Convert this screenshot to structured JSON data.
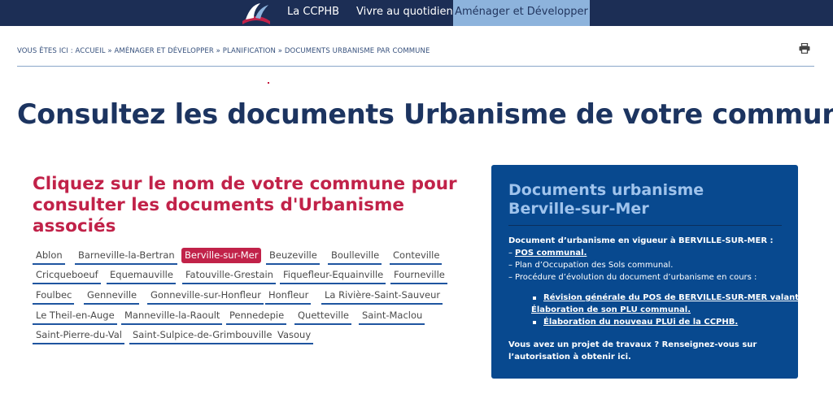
{
  "nav": {
    "items": [
      {
        "label": "La CCPHB"
      },
      {
        "label": "Vivre au quotidien"
      },
      {
        "label": "Aménager et Développer",
        "active": true
      }
    ],
    "colors": {
      "bar": "#1c2e55",
      "active_bg": "#8db3dc"
    }
  },
  "breadcrumb": "VOUS ÊTES ICI : ACCUEIL » AMÉNAGER ET DÉVELOPPER » PLANIFICATION » DOCUMENTS URBANISME PAR COMMUNE",
  "page_title": "Consultez les documents Urbanisme de votre commune",
  "left": {
    "heading": "Cliquez sur le nom de votre commune pour consulter les documents d'Urbanisme associés",
    "selected": "Berville-sur-Mer",
    "communes": [
      "Ablon",
      "Barneville-la-Bertran",
      "Berville-sur-Mer",
      "Beuzeville",
      "Boulleville",
      "Conteville",
      "Cricqueboeuf",
      "Equemauville",
      "Fatouville-Grestain",
      "Fiquefleur-Equainville",
      "Fourneville",
      "Foulbec",
      "Genneville",
      "Gonneville-sur-Honfleur",
      "Honfleur",
      "La Rivière-Saint-Sauveur",
      "Le Theil-en-Auge",
      "Manneville-la-Raoult",
      "Pennedepie",
      "Quetteville",
      "Saint-Maclou",
      "Saint-Pierre-du-Val",
      "Saint-Sulpice-de-Grimbouville",
      "Vasouy"
    ]
  },
  "panel": {
    "title": "Documents urbanisme Berville-sur-Mer",
    "in_force": "Document d’urbanisme en vigueur à BERVILLE-SUR-MER :",
    "pos_link": "POS communal.",
    "pos_text": "Plan d’Occupation des Sols communal.",
    "procedure": "Procédure d’évolution du document d’urbanisme en cours :",
    "item1_line1": "Révision générale du POS de BERVILLE-SUR-MER valant",
    "item1_line2": "Élaboration de son PLU communal.",
    "item2": "Élaboration du nouveau PLUi de la CCPHB.",
    "cta_line1": "Vous avez un projet de travaux ? Renseignez-vous sur",
    "cta_line2": "l’autorisation à obtenir ici.",
    "colors": {
      "bg": "#08498f",
      "title": "#9fc3ec"
    }
  },
  "icons": {
    "logo": "ccphb-logo",
    "print": "print-icon"
  },
  "accent_color": "#c12249"
}
